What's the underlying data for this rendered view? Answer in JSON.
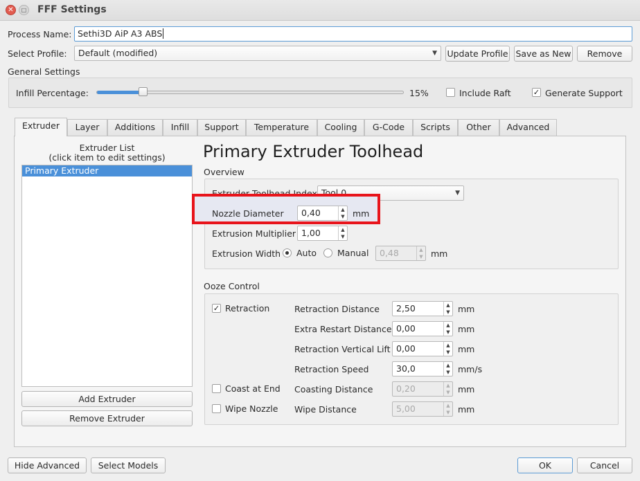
{
  "window": {
    "title": "FFF Settings"
  },
  "process": {
    "label": "Process Name:",
    "value": "Sethi3D AiP A3 ABS"
  },
  "profile": {
    "label": "Select Profile:",
    "value": "Default (modified)",
    "update_label": "Update Profile",
    "save_as_label": "Save as New",
    "remove_label": "Remove"
  },
  "general": {
    "title": "General Settings",
    "infill_label": "Infill Percentage:",
    "infill_value_text": "15%",
    "infill_fraction": 0.15,
    "include_raft_label": "Include Raft",
    "include_raft_checked": false,
    "generate_support_label": "Generate Support",
    "generate_support_checked": true
  },
  "tabs": [
    "Extruder",
    "Layer",
    "Additions",
    "Infill",
    "Support",
    "Temperature",
    "Cooling",
    "G-Code",
    "Scripts",
    "Other",
    "Advanced"
  ],
  "extruder_list": {
    "title_line1": "Extruder List",
    "title_line2": "(click item to edit settings)",
    "items": [
      "Primary Extruder"
    ],
    "add_label": "Add Extruder",
    "remove_label": "Remove Extruder"
  },
  "toolhead": {
    "heading": "Primary Extruder Toolhead",
    "overview_title": "Overview",
    "index_label": "Extruder Toolhead Index",
    "index_value": "Tool 0",
    "nozzle_label": "Nozzle Diameter",
    "nozzle_value": "0,40",
    "nozzle_unit": "mm",
    "multiplier_label": "Extrusion Multiplier",
    "multiplier_value": "1,00",
    "width_label": "Extrusion Width",
    "width_auto_label": "Auto",
    "width_manual_label": "Manual",
    "width_value": "0,48",
    "width_unit": "mm"
  },
  "ooze": {
    "title": "Ooze Control",
    "retraction_label": "Retraction",
    "retraction_checked": true,
    "coast_label": "Coast at End",
    "coast_checked": false,
    "wipe_label": "Wipe Nozzle",
    "wipe_checked": false,
    "rows": [
      {
        "label": "Retraction Distance",
        "value": "2,50",
        "unit": "mm"
      },
      {
        "label": "Extra Restart Distance",
        "value": "0,00",
        "unit": "mm"
      },
      {
        "label": "Retraction Vertical Lift",
        "value": "0,00",
        "unit": "mm"
      },
      {
        "label": "Retraction Speed",
        "value": "30,0",
        "unit": "mm/s"
      },
      {
        "label": "Coasting Distance",
        "value": "0,20",
        "unit": "mm"
      },
      {
        "label": "Wipe Distance",
        "value": "5,00",
        "unit": "mm"
      }
    ]
  },
  "footer": {
    "hide_advanced_label": "Hide Advanced",
    "select_models_label": "Select Models",
    "ok_label": "OK",
    "cancel_label": "Cancel"
  },
  "colors": {
    "accent": "#4a90d9",
    "highlight_box": "#e8141b"
  }
}
